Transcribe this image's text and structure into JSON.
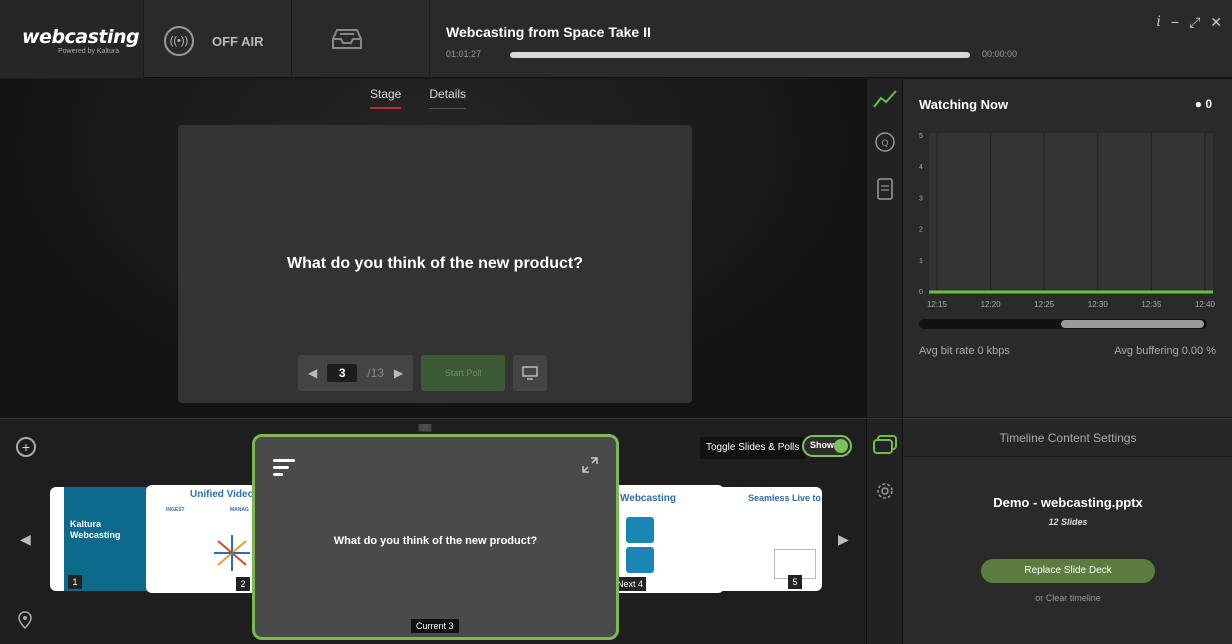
{
  "header": {
    "logo": "webcasting",
    "logo_sub": "Powered by Kaltura",
    "status": "OFF AIR",
    "event_title": "Webcasting from Space Take II",
    "elapsed": "01:01:27",
    "remaining": "00:00:00",
    "progress_fraction": 1.0
  },
  "stage": {
    "tabs": [
      {
        "label": "Stage"
      },
      {
        "label": "Details"
      }
    ],
    "question": "What do you think of the new product?",
    "page_current": "3",
    "page_total": "/13",
    "start_poll_label": "Start Poll"
  },
  "watch": {
    "title": "Watching Now",
    "viewers": "0",
    "y_ticks": [
      "0",
      "1",
      "2",
      "3",
      "4",
      "5"
    ],
    "x_ticks": [
      "12:15",
      "12:20",
      "12:25",
      "12:30",
      "12:35",
      "12:40"
    ],
    "avg_bitrate": "Avg bit rate 0 kbps",
    "avg_buffering": "Avg buffering 0.00 %",
    "line_color": "#6dc142"
  },
  "timeline": {
    "toggle_label": "Toggle Slides & Polls",
    "toggle_state": "Show",
    "thumbs": [
      {
        "num": "1",
        "title": "Kaltura Webcasting"
      },
      {
        "num": "2",
        "title": "Unified Video",
        "col1": "INGEST",
        "col2": "MANAG"
      },
      {
        "num": "Next 4",
        "title": "Webcasting"
      },
      {
        "num": "5",
        "title": "Seamless Live to"
      }
    ],
    "current_question": "What do you think of the new product?",
    "current_label": "Current 3"
  },
  "settings": {
    "header": "Timeline Content Settings",
    "deck_name": "Demo - webcasting.pptx",
    "deck_slides": "12 Slides",
    "replace_label": "Replace Slide Deck",
    "clear_label": "or Clear timeline"
  }
}
